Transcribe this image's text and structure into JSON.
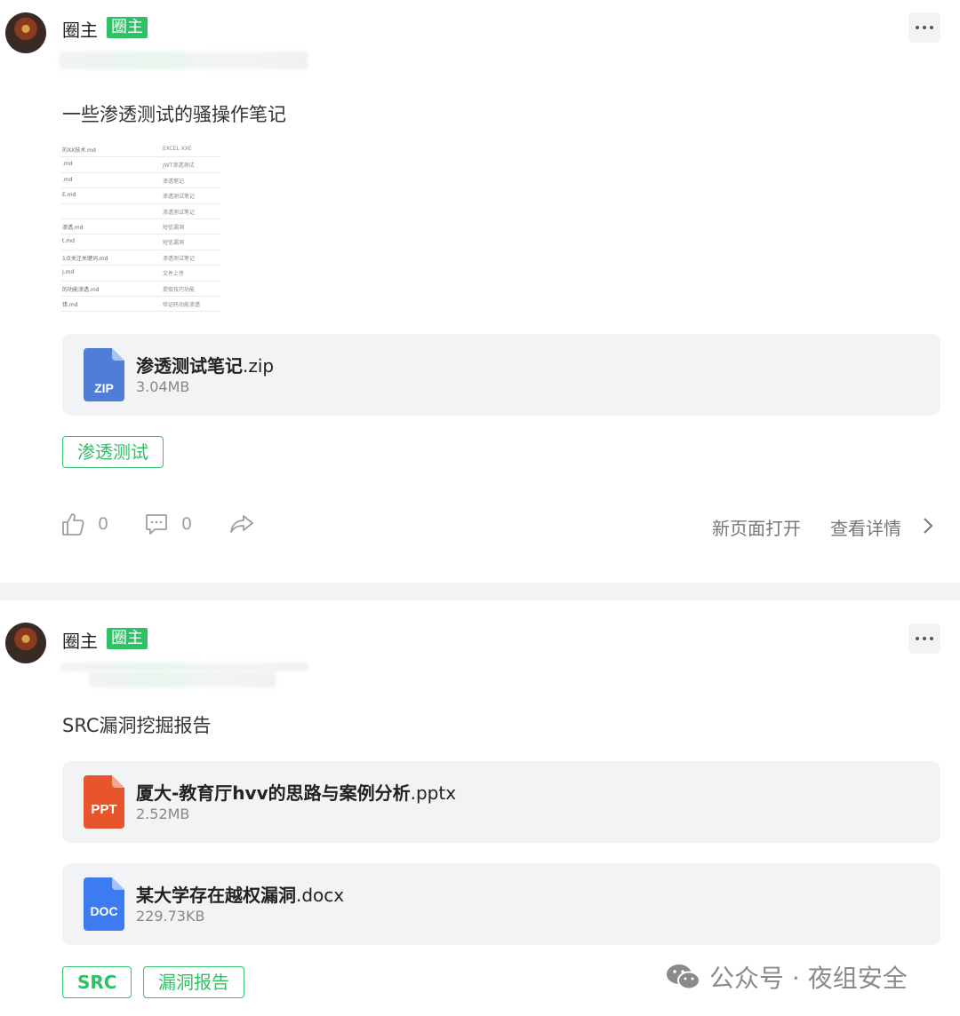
{
  "posts": [
    {
      "author": "圈主",
      "role_badge": "圈主",
      "text": "一些渗透测试的骚操作笔记",
      "attachment_preview": [
        {
          "left": "的XX技术.md",
          "right": "EXCEL XXE"
        },
        {
          "left": ".md",
          "right": "JWT渗透测试"
        },
        {
          "left": ".md",
          "right": "渗透笔记"
        },
        {
          "left": "E.md",
          "right": "渗透测试笔记"
        },
        {
          "left": "",
          "right": "渗透测试笔记"
        },
        {
          "left": "渗透.md",
          "right": "短信漏洞"
        },
        {
          "left": "t.md",
          "right": "短信漏洞"
        },
        {
          "left": "1点关注关键词.md",
          "right": "渗透测试笔记"
        },
        {
          "left": "J.md",
          "right": "文件上传"
        },
        {
          "left": "的功能渗透.md",
          "right": "提取技巧功能"
        },
        {
          "left": "错.md",
          "right": "验证码功能渗透"
        }
      ],
      "files": [
        {
          "name": "渗透测试笔记",
          "ext": ".zip",
          "size": "3.04MB",
          "icon_label": "ZIP",
          "icon_color": "#4e7ed8"
        }
      ],
      "tags": [
        "渗透测试"
      ],
      "likes": "0",
      "comments": "0",
      "open_new_page": "新页面打开",
      "view_details": "查看详情"
    },
    {
      "author": "圈主",
      "role_badge": "圈主",
      "text": "SRC漏洞挖掘报告",
      "files": [
        {
          "name": "厦大-教育厅hvv的思路与案例分析",
          "ext": ".pptx",
          "size": "2.52MB",
          "icon_label": "PPT",
          "icon_color": "#e8542c"
        },
        {
          "name": "某大学存在越权漏洞",
          "ext": ".docx",
          "size": "229.73KB",
          "icon_label": "DOC",
          "icon_color": "#3c7cf0"
        }
      ],
      "tags": [
        "SRC",
        "漏洞报告"
      ]
    }
  ],
  "watermark": "公众号 · 夜组安全",
  "colors": {
    "accent_green": "#2ec166",
    "card_bg": "#f2f3f5"
  }
}
